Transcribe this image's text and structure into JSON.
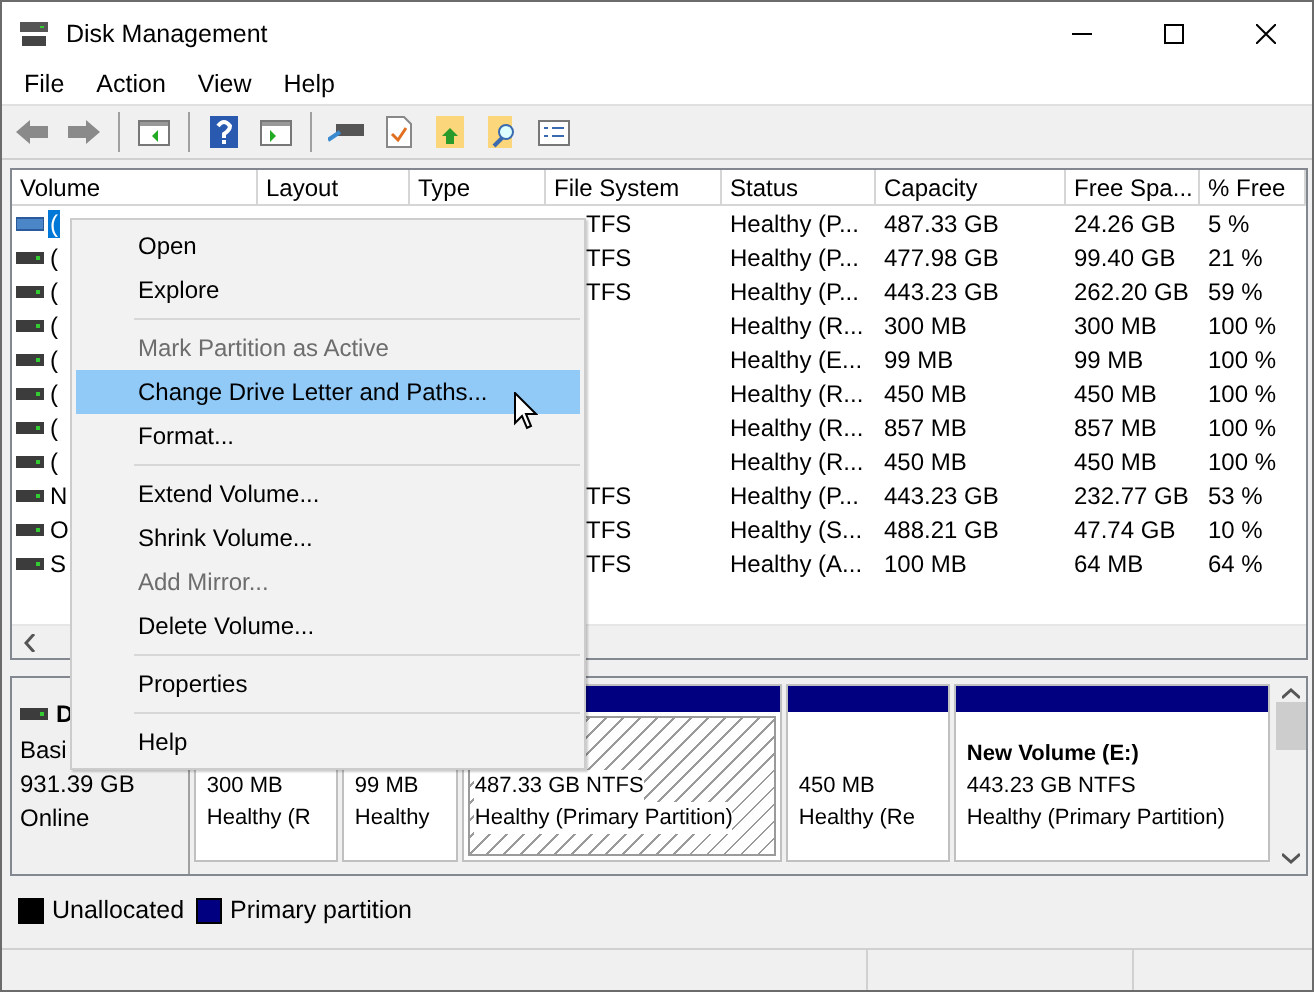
{
  "window": {
    "title": "Disk Management"
  },
  "menu_bar": [
    "File",
    "Action",
    "View",
    "Help"
  ],
  "table": {
    "columns": [
      "Volume",
      "Layout",
      "Type",
      "File System",
      "Status",
      "Capacity",
      "Free Spa...",
      "% Free"
    ],
    "rows": [
      {
        "volume": "(",
        "file_system": "TFS",
        "status": "Healthy (P...",
        "capacity": "487.33 GB",
        "free_space": "24.26 GB",
        "percent_free": "5 %",
        "selected": true
      },
      {
        "volume": "(",
        "file_system": "TFS",
        "status": "Healthy (P...",
        "capacity": "477.98 GB",
        "free_space": "99.40 GB",
        "percent_free": "21 %",
        "selected": false
      },
      {
        "volume": "(",
        "file_system": "TFS",
        "status": "Healthy (P...",
        "capacity": "443.23 GB",
        "free_space": "262.20 GB",
        "percent_free": "59 %",
        "selected": false
      },
      {
        "volume": "(",
        "status": "Healthy (R...",
        "capacity": "300 MB",
        "free_space": "300 MB",
        "percent_free": "100 %",
        "selected": false
      },
      {
        "volume": "(",
        "status": "Healthy (E...",
        "capacity": "99 MB",
        "free_space": "99 MB",
        "percent_free": "100 %",
        "selected": false
      },
      {
        "volume": "(",
        "status": "Healthy (R...",
        "capacity": "450 MB",
        "free_space": "450 MB",
        "percent_free": "100 %",
        "selected": false
      },
      {
        "volume": "(",
        "status": "Healthy (R...",
        "capacity": "857 MB",
        "free_space": "857 MB",
        "percent_free": "100 %",
        "selected": false
      },
      {
        "volume": "(",
        "status": "Healthy (R...",
        "capacity": "450 MB",
        "free_space": "450 MB",
        "percent_free": "100 %",
        "selected": false
      },
      {
        "volume": "N",
        "file_system": "TFS",
        "status": "Healthy (P...",
        "capacity": "443.23 GB",
        "free_space": "232.77 GB",
        "percent_free": "53 %",
        "selected": false
      },
      {
        "volume": "O",
        "file_system": "TFS",
        "status": "Healthy (S...",
        "capacity": "488.21 GB",
        "free_space": "47.74 GB",
        "percent_free": "10 %",
        "selected": false
      },
      {
        "volume": "S",
        "file_system": "TFS",
        "status": "Healthy (A...",
        "capacity": "100 MB",
        "free_space": "64 MB",
        "percent_free": "64 %",
        "selected": false
      }
    ]
  },
  "disk": {
    "name": "D",
    "type": "Basi",
    "size": "931.39 GB",
    "status": "Online"
  },
  "partitions": [
    {
      "lines": [
        "300 MB",
        "Healthy (R"
      ],
      "selected": false
    },
    {
      "lines": [
        "99 MB",
        "Healthy"
      ],
      "selected": false
    },
    {
      "lines": [
        "487.33 GB NTFS",
        "Healthy (Primary Partition)"
      ],
      "selected": true
    },
    {
      "lines": [
        "450 MB",
        "Healthy (Re"
      ],
      "selected": false
    },
    {
      "title": "New Volume  (E:)",
      "lines": [
        "443.23 GB NTFS",
        "Healthy (Primary Partition)"
      ],
      "selected": false
    }
  ],
  "legend": [
    {
      "label": "Unallocated",
      "color": "#000000"
    },
    {
      "label": "Primary partition",
      "color": "#000080"
    }
  ],
  "context_menu": [
    {
      "kind": "item",
      "label": "Open",
      "disabled": false,
      "selected": false
    },
    {
      "kind": "item",
      "label": "Explore",
      "disabled": false,
      "selected": false
    },
    {
      "kind": "separator"
    },
    {
      "kind": "item",
      "label": "Mark Partition as Active",
      "disabled": true,
      "selected": false
    },
    {
      "kind": "item",
      "label": "Change Drive Letter and Paths...",
      "disabled": false,
      "selected": true
    },
    {
      "kind": "item",
      "label": "Format...",
      "disabled": false,
      "selected": false
    },
    {
      "kind": "separator"
    },
    {
      "kind": "item",
      "label": "Extend Volume...",
      "disabled": false,
      "selected": false
    },
    {
      "kind": "item",
      "label": "Shrink Volume...",
      "disabled": false,
      "selected": false
    },
    {
      "kind": "item",
      "label": "Add Mirror...",
      "disabled": true,
      "selected": false
    },
    {
      "kind": "item",
      "label": "Delete Volume...",
      "disabled": false,
      "selected": false
    },
    {
      "kind": "separator"
    },
    {
      "kind": "item",
      "label": "Properties",
      "disabled": false,
      "selected": false
    },
    {
      "kind": "separator"
    },
    {
      "kind": "item",
      "label": "Help",
      "disabled": false,
      "selected": false
    }
  ]
}
